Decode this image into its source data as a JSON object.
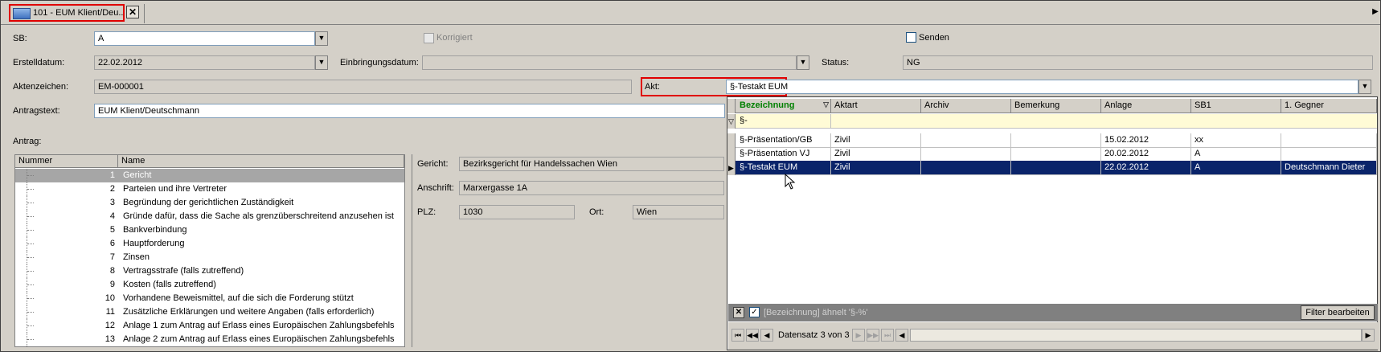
{
  "tab": {
    "label": "101 - EUM Klient/Deu...",
    "close": "✕"
  },
  "icons": {
    "tab": "document-icon",
    "close": "close-icon",
    "dropdown": "chevron-down-icon",
    "filter": "filter-icon"
  },
  "form": {
    "sb_label": "SB:",
    "sb_value": "A",
    "korrigiert_label": "Korrigiert",
    "senden_label": "Senden",
    "erstelldatum_label": "Erstelldatum:",
    "erstelldatum_value": "22.02.2012",
    "einbringungsdatum_label": "Einbringungsdatum:",
    "einbringungsdatum_value": "",
    "status_label": "Status:",
    "status_value": "NG",
    "aktenzeichen_label": "Aktenzeichen:",
    "aktenzeichen_value": "EM-000001",
    "akt_label": "Akt:",
    "akt_value": "§-Testakt EUM",
    "antragstext_label": "Antragstext:",
    "antragstext_value": "EUM Klient/Deutschmann",
    "antrag_label": "Antrag:"
  },
  "tree": {
    "headers": [
      "Nummer",
      "Name"
    ],
    "rows": [
      {
        "num": "1",
        "name": "Gericht"
      },
      {
        "num": "2",
        "name": "Parteien und ihre Vertreter"
      },
      {
        "num": "3",
        "name": "Begründung der gerichtlichen Zuständigkeit"
      },
      {
        "num": "4",
        "name": "Gründe dafür, dass die Sache als grenzüberschreitend anzusehen ist"
      },
      {
        "num": "5",
        "name": "Bankverbindung"
      },
      {
        "num": "6",
        "name": "Hauptforderung"
      },
      {
        "num": "7",
        "name": "Zinsen"
      },
      {
        "num": "8",
        "name": "Vertragsstrafe (falls zutreffend)"
      },
      {
        "num": "9",
        "name": "Kosten (falls zutreffend)"
      },
      {
        "num": "10",
        "name": "Vorhandene Beweismittel, auf die sich die Forderung stützt"
      },
      {
        "num": "11",
        "name": "Zusätzliche Erklärungen und weitere Angaben (falls erforderlich)"
      },
      {
        "num": "12",
        "name": "Anlage 1 zum Antrag auf Erlass eines Europäischen Zahlungsbefehls"
      },
      {
        "num": "13",
        "name": "Anlage 2 zum Antrag auf Erlass eines Europäischen Zahlungsbefehls"
      }
    ]
  },
  "detail": {
    "gericht_label": "Gericht:",
    "gericht_value": "Bezirksgericht für Handelssachen Wien",
    "anschrift_label": "Anschrift:",
    "anschrift_value": "Marxergasse 1A",
    "plz_label": "PLZ:",
    "plz_value": "1030",
    "ort_label": "Ort:",
    "ort_value": "Wien"
  },
  "grid": {
    "headers": [
      "Bezeichnung",
      "Aktart",
      "Archiv",
      "Bemerkung",
      "Anlage",
      "SB1",
      "1. Gegner"
    ],
    "filter_value": "§-",
    "rows": [
      [
        "§-Präsentation/GB",
        "Zivil",
        "",
        "",
        "15.02.2012",
        "xx",
        ""
      ],
      [
        "§-Präsentation VJ",
        "Zivil",
        "",
        "",
        "20.02.2012",
        "A",
        ""
      ],
      [
        "§-Testakt EUM",
        "Zivil",
        "",
        "",
        "22.02.2012",
        "A",
        "Deutschmann Dieter"
      ]
    ],
    "filter_text": "[Bezeichnung] ähnelt '§-%'",
    "filter_button": "Filter bearbeiten",
    "record_text": "Datensatz 3 von 3"
  }
}
